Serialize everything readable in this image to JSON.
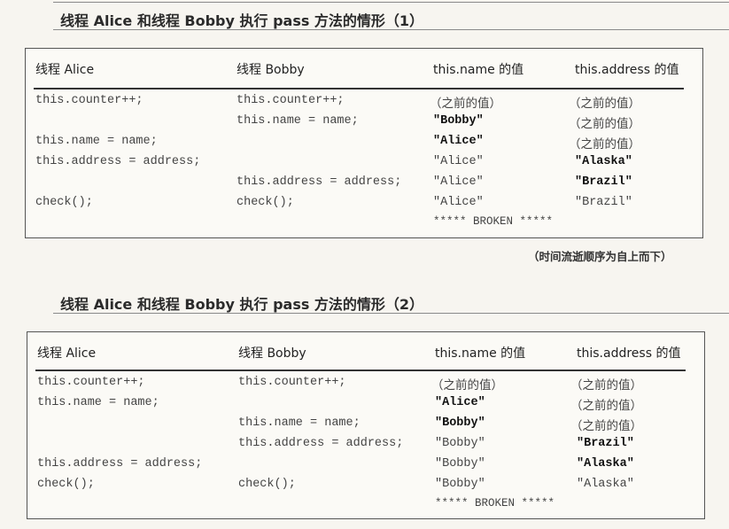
{
  "figure1": {
    "title": "线程 Alice 和线程 Bobby 执行 pass 方法的情形（1）",
    "headers": [
      "线程 Alice",
      "线程 Bobby",
      "this.name 的值",
      "this.address 的值"
    ],
    "rows": [
      {
        "alice": "this.counter++;",
        "bobby": "this.counter++;",
        "name": "（之前的值）",
        "address": "（之前的值）"
      },
      {
        "alice": "",
        "bobby": "this.name = name;",
        "name": "\"Bobby\"",
        "address": "（之前的值）"
      },
      {
        "alice": "this.name = name;",
        "bobby": "",
        "name": "\"Alice\"",
        "address": "（之前的值）"
      },
      {
        "alice": "this.address = address;",
        "bobby": "",
        "name": "\"Alice\"",
        "address": "\"Alaska\""
      },
      {
        "alice": "",
        "bobby": "this.address = address;",
        "name": "\"Alice\"",
        "address": "\"Brazil\""
      },
      {
        "alice": "check();",
        "bobby": "check();",
        "name": "\"Alice\"",
        "address": "\"Brazil\""
      }
    ],
    "broken": "***** BROKEN *****"
  },
  "caption": "（时间流逝顺序为自上而下）",
  "figure2": {
    "title": "线程 Alice 和线程 Bobby 执行 pass 方法的情形（2）",
    "headers": [
      "线程 Alice",
      "线程 Bobby",
      "this.name 的值",
      "this.address 的值"
    ],
    "rows": [
      {
        "alice": "this.counter++;",
        "bobby": "this.counter++;",
        "name": "（之前的值）",
        "address": "（之前的值）"
      },
      {
        "alice": "this.name = name;",
        "bobby": "",
        "name": "\"Alice\"",
        "address": "（之前的值）"
      },
      {
        "alice": "",
        "bobby": "this.name = name;",
        "name": "\"Bobby\"",
        "address": "（之前的值）"
      },
      {
        "alice": "",
        "bobby": "this.address = address;",
        "name": "\"Bobby\"",
        "address": "\"Brazil\""
      },
      {
        "alice": "this.address = address;",
        "bobby": "",
        "name": "\"Bobby\"",
        "address": "\"Alaska\""
      },
      {
        "alice": "check();",
        "bobby": "check();",
        "name": "\"Bobby\"",
        "address": "\"Alaska\""
      }
    ],
    "broken": "***** BROKEN *****"
  }
}
